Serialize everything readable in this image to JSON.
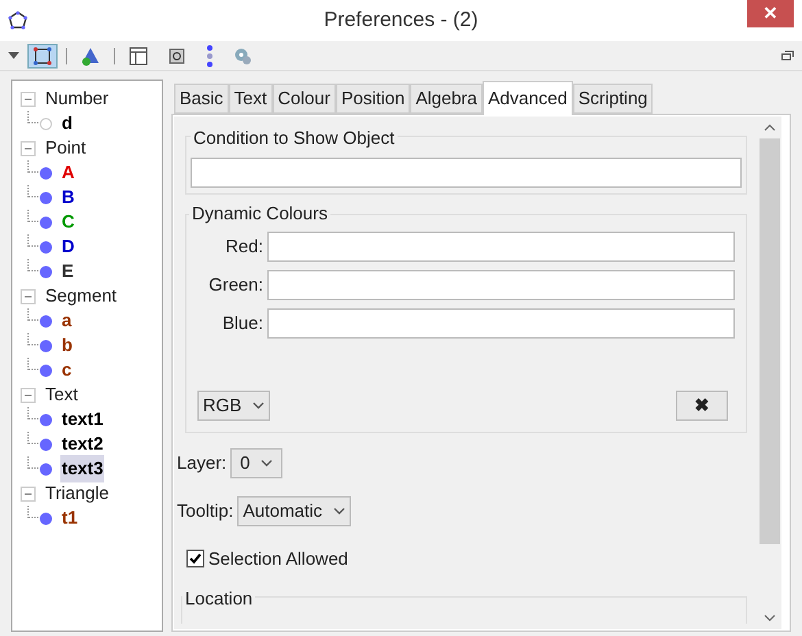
{
  "window": {
    "title": "Preferences - (2)",
    "close_label": "✕"
  },
  "toolbar": {
    "items": [
      {
        "kind": "move",
        "selected": true
      },
      {
        "kind": "triangle",
        "selected": false
      },
      {
        "kind": "layout",
        "selected": false
      },
      {
        "kind": "points",
        "selected": false
      },
      {
        "kind": "dots",
        "selected": false
      },
      {
        "kind": "gears",
        "selected": false
      }
    ]
  },
  "tree": {
    "groups": [
      {
        "label": "Number",
        "expanded": true,
        "children": [
          {
            "label": "d",
            "color": "#000000",
            "visible": false,
            "selected": false
          }
        ]
      },
      {
        "label": "Point",
        "expanded": true,
        "children": [
          {
            "label": "A",
            "color": "#e00000",
            "visible": true,
            "selected": false
          },
          {
            "label": "B",
            "color": "#0000cc",
            "visible": true,
            "selected": false
          },
          {
            "label": "C",
            "color": "#009900",
            "visible": true,
            "selected": false
          },
          {
            "label": "D",
            "color": "#0000cc",
            "visible": true,
            "selected": false
          },
          {
            "label": "E",
            "color": "#333333",
            "visible": true,
            "selected": false
          }
        ]
      },
      {
        "label": "Segment",
        "expanded": true,
        "children": [
          {
            "label": "a",
            "color": "#993300",
            "visible": true,
            "selected": false
          },
          {
            "label": "b",
            "color": "#993300",
            "visible": true,
            "selected": false
          },
          {
            "label": "c",
            "color": "#993300",
            "visible": true,
            "selected": false
          }
        ]
      },
      {
        "label": "Text",
        "expanded": true,
        "children": [
          {
            "label": "text1",
            "color": "#000000",
            "visible": true,
            "selected": false
          },
          {
            "label": "text2",
            "color": "#000000",
            "visible": true,
            "selected": false
          },
          {
            "label": "text3",
            "color": "#000000",
            "visible": true,
            "selected": true
          }
        ]
      },
      {
        "label": "Triangle",
        "expanded": true,
        "children": [
          {
            "label": "t1",
            "color": "#993300",
            "visible": true,
            "selected": false
          }
        ]
      }
    ]
  },
  "tabs": [
    {
      "label": "Basic",
      "selected": false
    },
    {
      "label": "Text",
      "selected": false
    },
    {
      "label": "Colour",
      "selected": false
    },
    {
      "label": "Position",
      "selected": false
    },
    {
      "label": "Algebra",
      "selected": false
    },
    {
      "label": "Advanced",
      "selected": true
    },
    {
      "label": "Scripting",
      "selected": false
    }
  ],
  "condition": {
    "title": "Condition to Show Object"
  },
  "dynamic_colours": {
    "title": "Dynamic Colours",
    "fields": [
      {
        "label": "Red:"
      },
      {
        "label": "Green:"
      },
      {
        "label": "Blue:"
      }
    ],
    "mode": "RGB",
    "clear_button": "✖"
  },
  "layer": {
    "label": "Layer:",
    "value": "0"
  },
  "tooltip": {
    "label": "Tooltip:",
    "value": "Automatic"
  },
  "selection_allowed": {
    "label": "Selection Allowed",
    "checked": true
  },
  "location": {
    "title": "Location"
  }
}
